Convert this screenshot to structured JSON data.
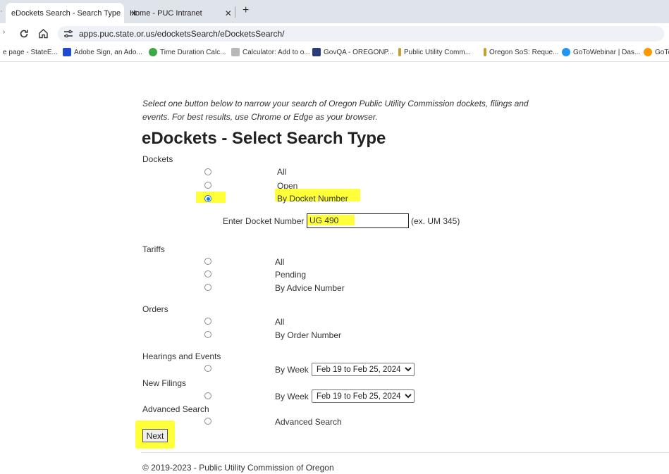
{
  "browser": {
    "tabs": [
      {
        "label": "eDockets Search - Search Type",
        "close": "✕"
      },
      {
        "label": "Home - PUC Intranet",
        "close": "✕"
      }
    ],
    "new_tab": "+",
    "url": "apps.puc.state.or.us/edocketsSearch/eDocketsSearch/",
    "bookmarks": [
      "e page - StateE...",
      "Adobe Sign, an Ado...",
      "Time Duration Calc...",
      "Calculator: Add to o...",
      "GovQA - OREGONP...",
      "Public Utility Comm...",
      "Oregon SoS: Reque...",
      "GoToWebinar | Das...",
      "GoTo"
    ],
    "bookmark_icon_colors": [
      "#aaaaaa",
      "#1e4bd2",
      "#3fa848",
      "#b7b7b7",
      "#2c3e7a",
      "#c8a02d",
      "#c8a02d",
      "#2196f3",
      "#ff9800"
    ],
    "highlight_color": "#ffff3a"
  },
  "page": {
    "intro": "Select one button below to narrow your search of Oregon Public Utility Commission dockets, filings and events. For best results, use Chrome or Edge as your browser.",
    "title": "eDockets - Select Search Type",
    "dockets": {
      "heading": "Dockets",
      "options": [
        "All",
        "Open",
        "By Docket Number"
      ],
      "selected": "By Docket Number",
      "number_label": "Enter Docket Number",
      "number_value": "UG 490",
      "number_example": "(ex. UM 345)"
    },
    "tariffs": {
      "heading": "Tariffs",
      "options": [
        "All",
        "Pending",
        "By Advice Number"
      ]
    },
    "orders": {
      "heading": "Orders",
      "options": [
        "All",
        "By Order Number"
      ]
    },
    "hearings": {
      "heading": "Hearings and Events",
      "label": "By Week",
      "week": "Feb 19 to Feb 25, 2024"
    },
    "filings": {
      "heading": "New Filings",
      "label": "By Week",
      "week": "Feb 19 to Feb 25, 2024"
    },
    "advanced": {
      "heading": "Advanced Search",
      "label": "Advanced Search"
    },
    "next_button": "Next",
    "footer": "© 2019-2023 - Public Utility Commission of Oregon"
  }
}
